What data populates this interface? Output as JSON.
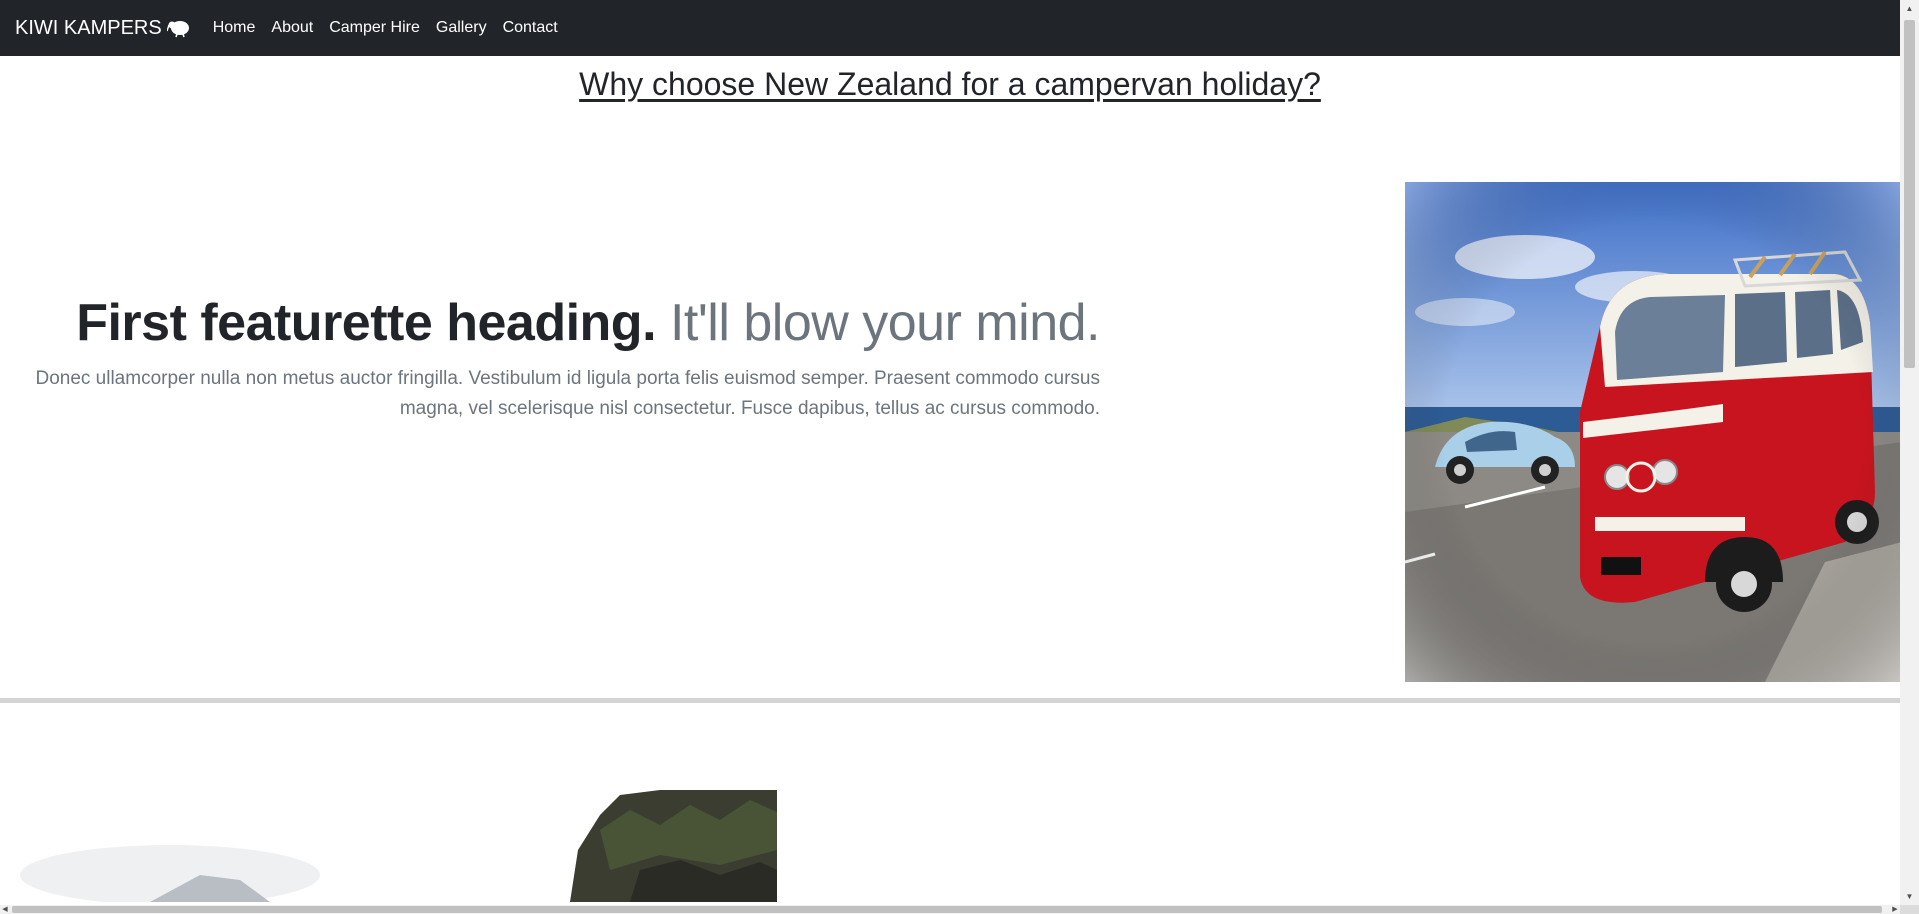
{
  "navbar": {
    "brand": "KIWI KAMPERS",
    "brand_icon": "kiwi-bird-icon",
    "links": [
      {
        "label": "Home"
      },
      {
        "label": "About"
      },
      {
        "label": "Camper Hire"
      },
      {
        "label": "Gallery"
      },
      {
        "label": "Contact"
      }
    ]
  },
  "page": {
    "heading": "Why choose New Zealand for a campervan holiday?"
  },
  "featurette": {
    "heading": "First featurette heading.",
    "heading_muted": "It'll blow your mind.",
    "lead": "Donec ullamcorper nulla non metus auctor fringilla. Vestibulum id ligula porta felis euismod semper. Praesent commodo cursus magna, vel scelerisque nisl consectetur. Fusce dapibus, tellus ac cursus commodo.",
    "image": "red-vw-campervan-photo"
  },
  "featurette2": {
    "image": "misty-fjord-mountains-photo"
  },
  "colors": {
    "navbar_bg": "#212529",
    "text_dark": "#212529",
    "text_muted": "#6c757d",
    "van_red": "#c8141e"
  }
}
